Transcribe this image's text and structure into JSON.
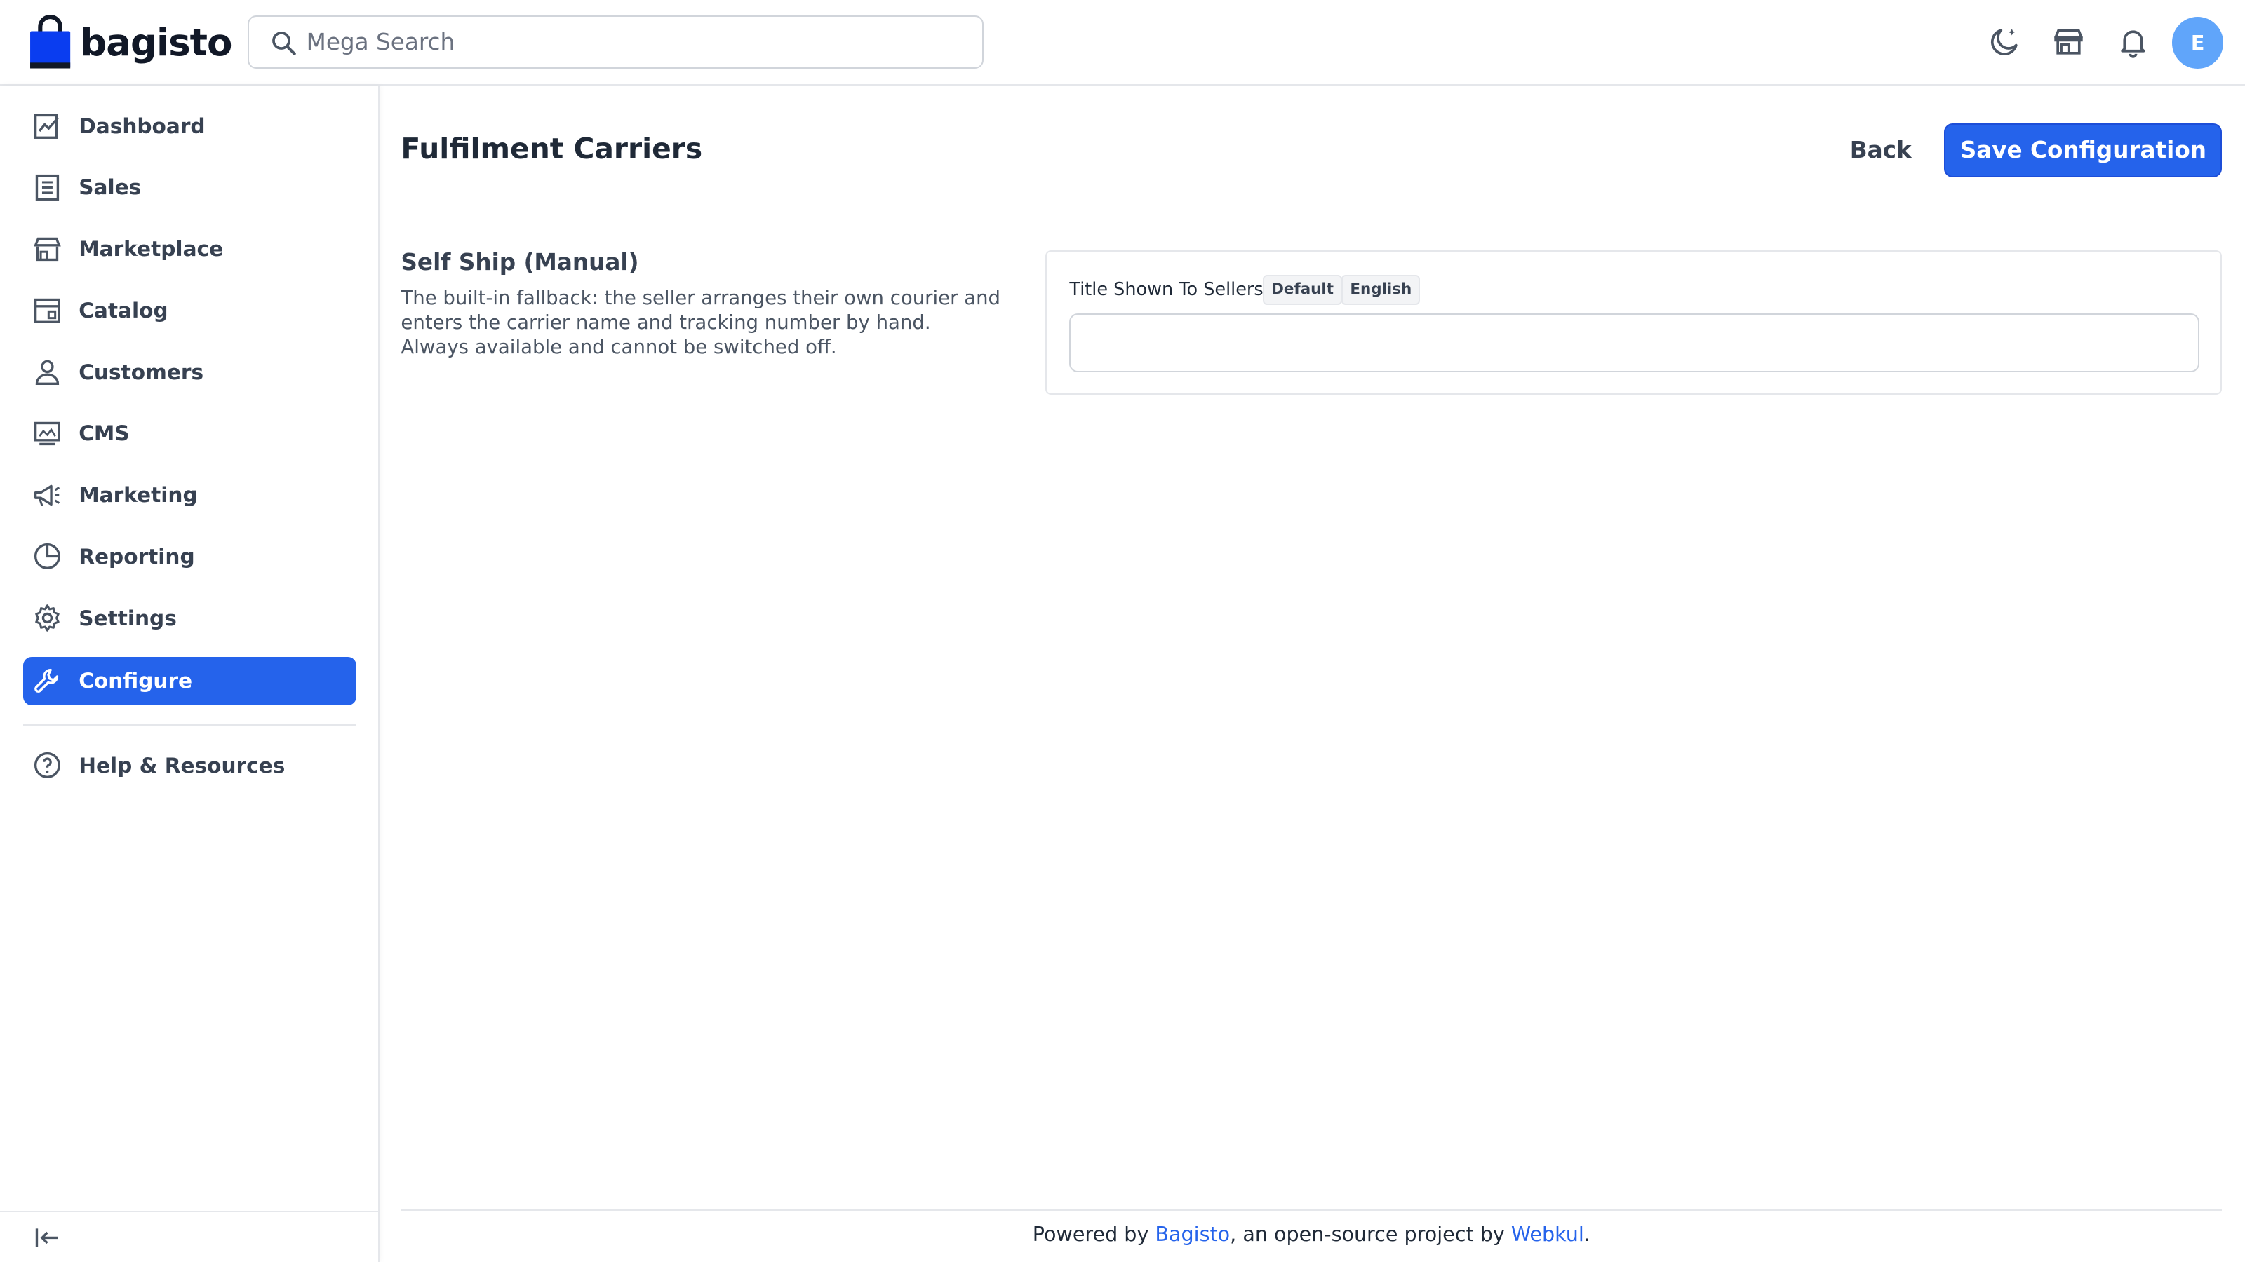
{
  "header": {
    "brand": "bagisto",
    "search_placeholder": "Mega Search",
    "avatar_initial": "E",
    "icons": [
      "moon-icon",
      "store-icon",
      "bell-icon"
    ]
  },
  "sidebar": {
    "items": [
      {
        "label": "Dashboard",
        "icon": "dashboard-icon"
      },
      {
        "label": "Sales",
        "icon": "receipt-icon"
      },
      {
        "label": "Marketplace",
        "icon": "store-icon"
      },
      {
        "label": "Catalog",
        "icon": "catalog-icon"
      },
      {
        "label": "Customers",
        "icon": "user-icon"
      },
      {
        "label": "CMS",
        "icon": "monitor-icon"
      },
      {
        "label": "Marketing",
        "icon": "megaphone-icon"
      },
      {
        "label": "Reporting",
        "icon": "pie-chart-icon"
      },
      {
        "label": "Settings",
        "icon": "gear-icon"
      },
      {
        "label": "Configure",
        "icon": "wrench-icon",
        "active": true
      }
    ],
    "help_label": "Help & Resources"
  },
  "page": {
    "title": "Fulfilment Carriers",
    "back_label": "Back",
    "save_label": "Save Configuration"
  },
  "section": {
    "title": "Self Ship (Manual)",
    "description": "The built-in fallback: the seller arranges their own courier and enters the carrier name and tracking number by hand. Always available and cannot be switched off.",
    "field": {
      "label": "Title Shown To Sellers",
      "tags": [
        "Default",
        "English"
      ],
      "value": "",
      "placeholder": ""
    }
  },
  "footer": {
    "prefix": "Powered by ",
    "link1": "Bagisto",
    "middle": ", an open-source project by ",
    "link2": "Webkul",
    "suffix": "."
  },
  "colors": {
    "accent": "#2563eb",
    "avatar": "#60a5fa"
  }
}
